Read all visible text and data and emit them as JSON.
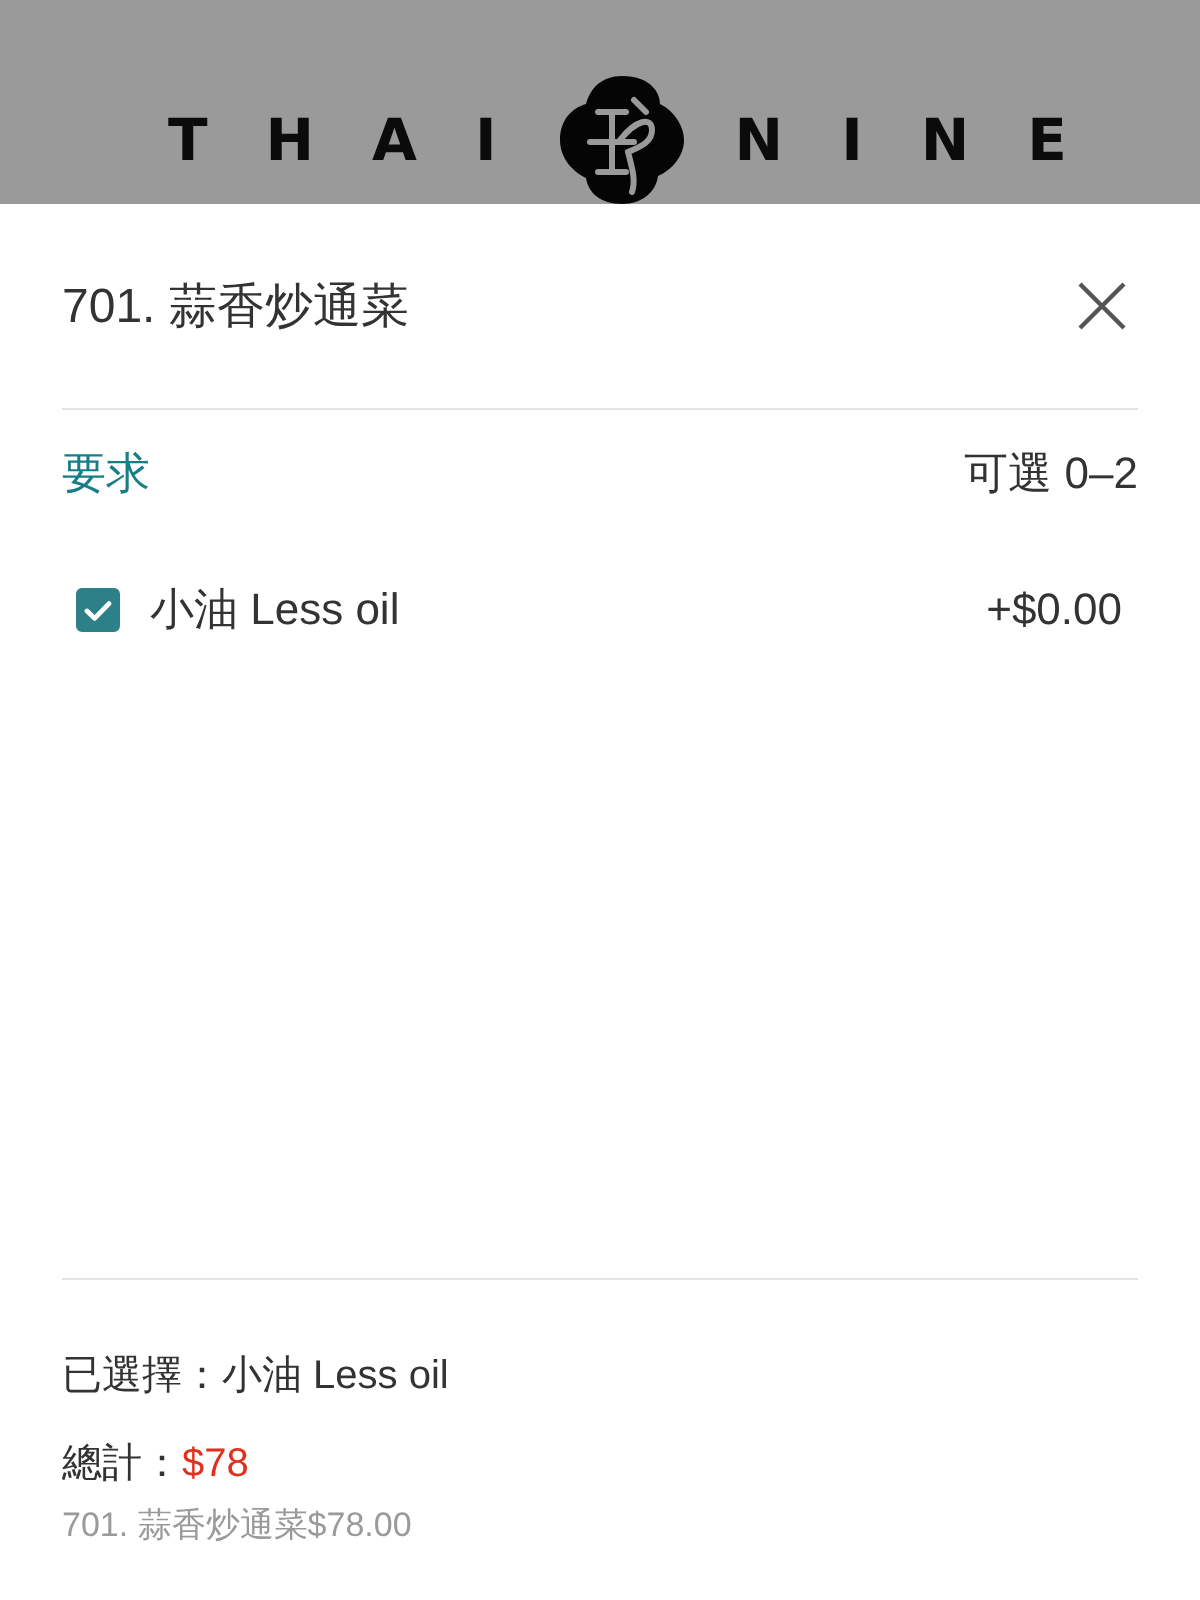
{
  "header": {
    "logo": {
      "left_word": "THAI",
      "right_word": "NINE"
    }
  },
  "dialog": {
    "title": "701. 蒜香炒通菜"
  },
  "option_group": {
    "title": "要求",
    "limit": "可選 0–2",
    "options": [
      {
        "label": "小油 Less oil",
        "price": "+$0.00",
        "checked": true
      }
    ]
  },
  "summary": {
    "selected": "已選擇：小油 Less oil",
    "total_label": "總計：",
    "total_value": "$78",
    "line_item": "701. 蒜香炒通菜$78.00"
  }
}
